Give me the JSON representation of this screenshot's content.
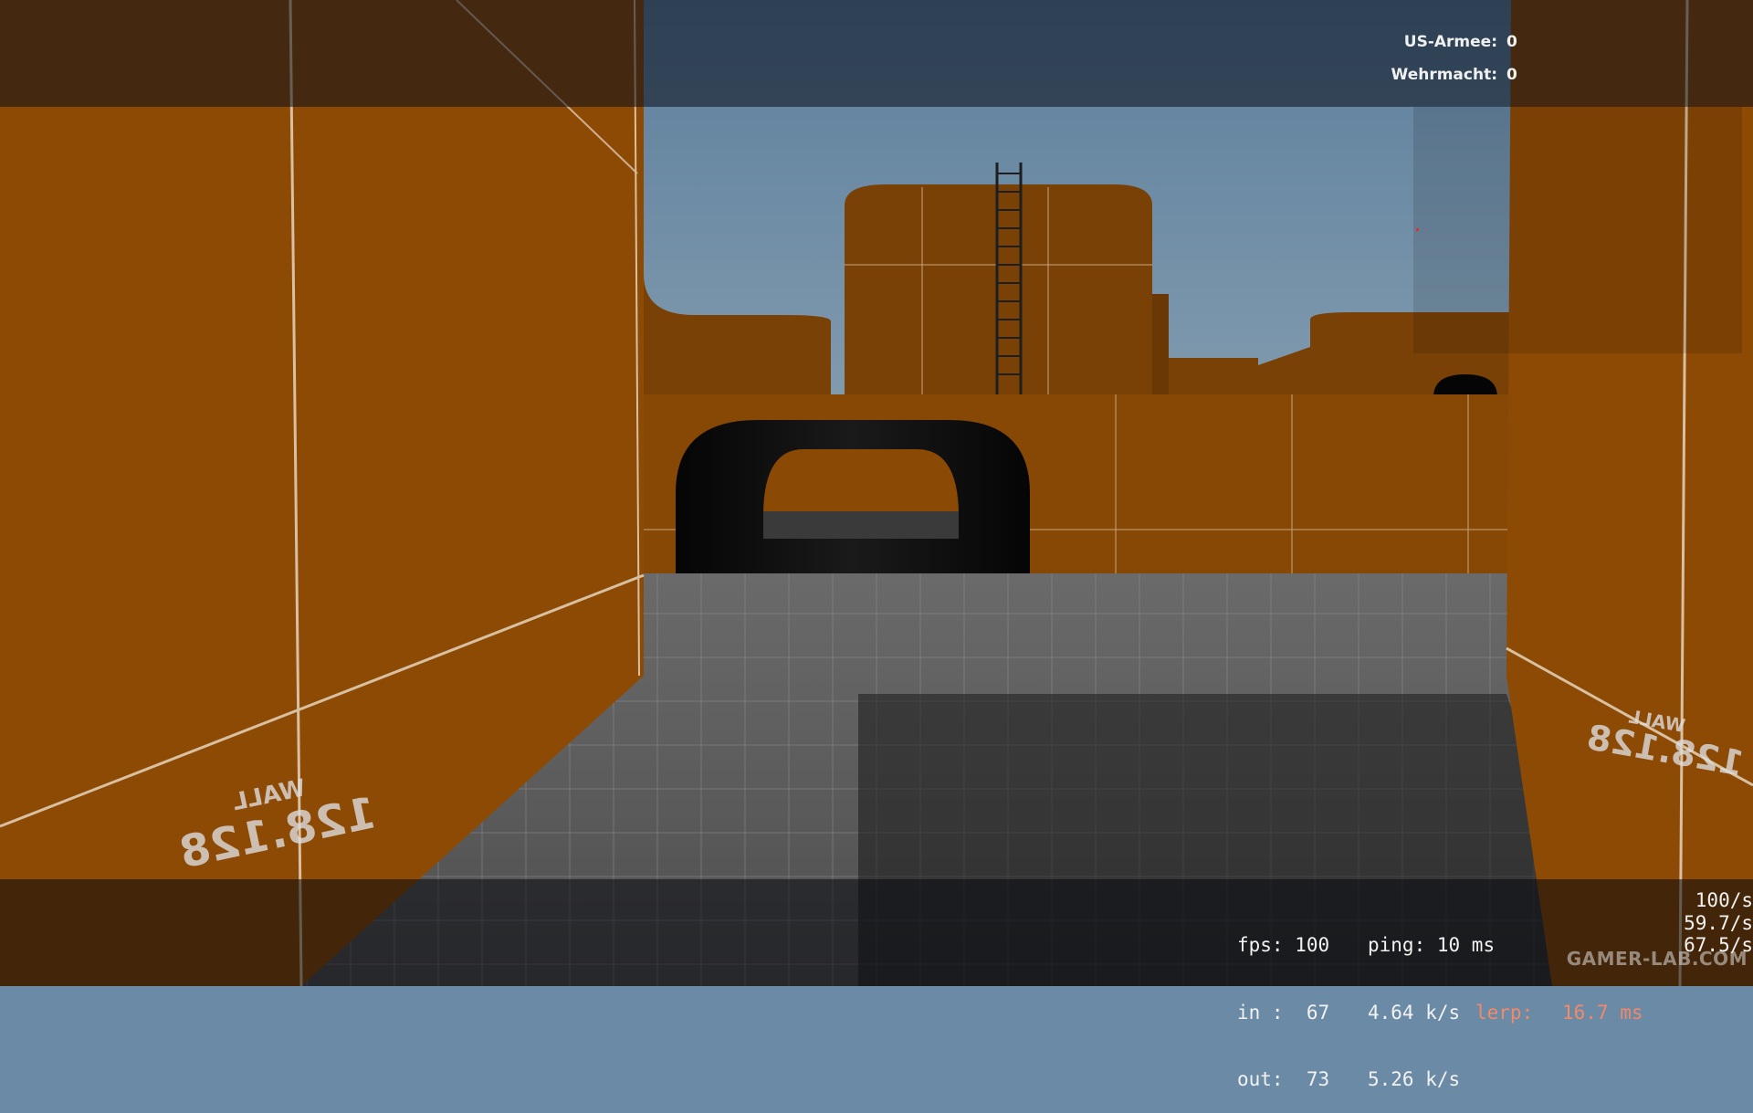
{
  "scoreboard": {
    "teams": [
      {
        "name": "US-Armee:",
        "score": "0"
      },
      {
        "name": "Wehrmacht:",
        "score": "0"
      }
    ]
  },
  "netgraph": {
    "fps_label": "fps:",
    "fps": "100",
    "ping_label": "ping:",
    "ping": "10 ms",
    "in_label": "in :",
    "in_packets": "67",
    "in_rate": "4.64 k/s",
    "lerp_label": "lerp:",
    "lerp": "16.7 ms",
    "out_label": "out:",
    "out_packets": "73",
    "out_rate": "5.26 k/s",
    "rate1": "100/s",
    "rate2": "59.7/s",
    "rate3": "67.5/s"
  },
  "map": {
    "wall_label": "WALL",
    "wall_size": "128.128"
  },
  "watermark": "GAMER-LAB.COM",
  "colors": {
    "wall_orange": "#8a4a06",
    "sky": "#6a8aa5",
    "floor": "#5a5a5a",
    "lerp_text": "#f08a6a"
  }
}
